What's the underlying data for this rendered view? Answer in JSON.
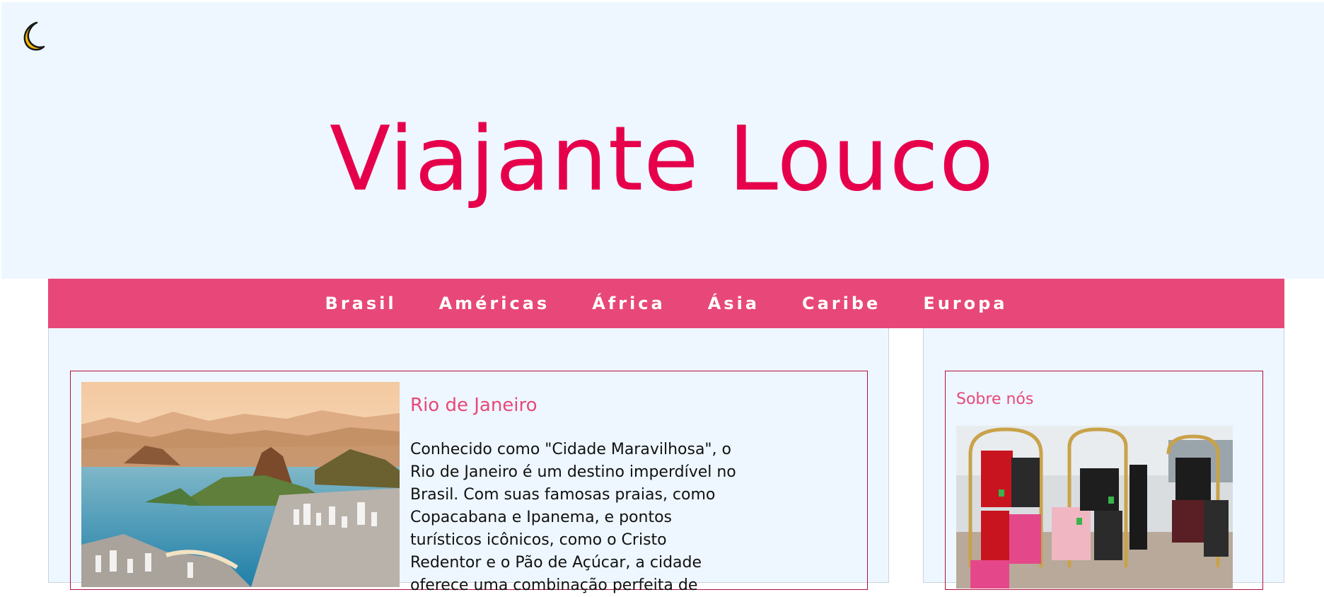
{
  "header": {
    "title": "Viajante Louco",
    "theme_toggle_icon": "crescent-moon-icon"
  },
  "nav": {
    "items": [
      "Brasil",
      "Américas",
      "África",
      "Ásia",
      "Caribe",
      "Europa"
    ]
  },
  "main": {
    "article": {
      "title": "Rio de Janeiro",
      "text": "Conhecido como \"Cidade Maravilhosa\", o Rio de Janeiro é um destino imperdível no Brasil. Com suas famosas praias, como Copacabana e Ipanema, e pontos turísticos icônicos, como o Cristo Redentor e o Pão de Açúcar, a cidade oferece uma combinação perfeita de"
    }
  },
  "sidebar": {
    "about_title": "Sobre nós"
  },
  "colors": {
    "accent": "#e6004c",
    "nav_bg": "#e84879",
    "page_bg": "#eef7ff",
    "card_border": "#b0103f"
  }
}
